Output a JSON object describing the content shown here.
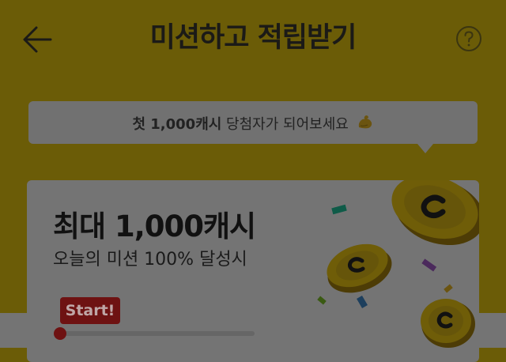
{
  "header": {
    "title": "미션하고 적립받기"
  },
  "banner": {
    "text_bold": "첫 1,000캐시",
    "text_rest": " 당첨자가 되어보세요"
  },
  "card": {
    "headline": "최대 1,000캐시",
    "subtext": "오늘의 미션 100% 달성시",
    "progress_label": "Start!",
    "progress_value": 0
  },
  "icons": {
    "back": "arrow-left-icon",
    "help": "question-circle-icon",
    "banner": "flexed-biceps-icon",
    "illustration": "coins-confetti-illustration"
  },
  "colors": {
    "background": "#6b5c07",
    "accent_red": "#6e1212",
    "card": "#747474"
  }
}
